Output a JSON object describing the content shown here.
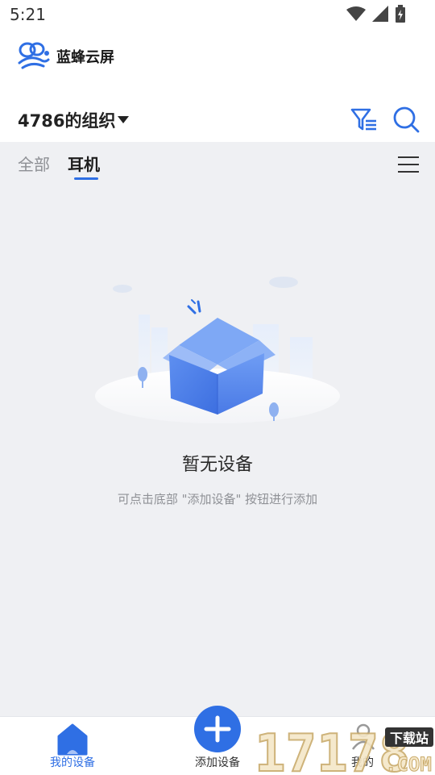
{
  "status_bar": {
    "time": "5:21"
  },
  "brand": {
    "name": "蓝蜂云屏"
  },
  "header": {
    "org_name": "4786的组织"
  },
  "tabs": [
    {
      "label": "全部",
      "active": false
    },
    {
      "label": "耳机",
      "active": true
    }
  ],
  "empty_state": {
    "title": "暂无设备",
    "hint": "可点击底部 \"添加设备\" 按钮进行添加"
  },
  "bottom_nav": [
    {
      "label": "我的设备",
      "active": true
    },
    {
      "label": "添加设备",
      "active": false
    },
    {
      "label": "我的",
      "active": false
    }
  ],
  "watermark": {
    "text": "17178",
    "badge": "下载站",
    "suffix": ".COM"
  },
  "colors": {
    "accent": "#2f6fe4",
    "background": "#eff0f3"
  },
  "icons": [
    "wifi-icon",
    "signal-icon",
    "battery-icon",
    "bee-logo",
    "caret-down-icon",
    "filter-icon",
    "search-icon",
    "menu-icon",
    "home-icon",
    "plus-icon",
    "user-icon"
  ]
}
